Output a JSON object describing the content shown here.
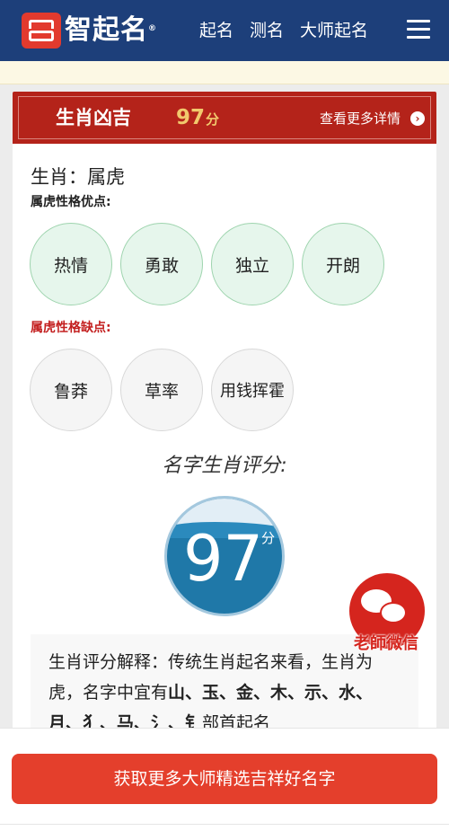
{
  "header": {
    "brand": "智起名",
    "registered": "®",
    "nav": [
      "起名",
      "测名",
      "大师起名"
    ]
  },
  "banner": {
    "title": "生肖凶吉",
    "score": "97",
    "score_unit": "分",
    "more_label": "查看更多详情",
    "arrow": "›"
  },
  "zodiac": {
    "line": "生肖：属虎",
    "good_label": "属虎性格优点:",
    "good_traits": [
      "热情",
      "勇敢",
      "独立",
      "开朗"
    ],
    "bad_label": "属虎性格缺点:",
    "bad_traits": [
      "鲁莽",
      "草率",
      "用钱挥霍"
    ]
  },
  "score": {
    "title": "名字生肖评分:",
    "value": "97",
    "unit": "分"
  },
  "explanation": {
    "prefix": "生肖评分解释：传统生肖起名来看，生肖为虎，名字中宜有",
    "radicals": "山、玉、金、木、示、水、月、犭、马、氵、钅",
    "suffix": "部首起名"
  },
  "wechat": {
    "label": "老師微信"
  },
  "footer": {
    "cta": "获取更多大师精选吉祥好名字"
  },
  "colors": {
    "header_bg": "#1d3f7a",
    "banner_bg": "#b4231a",
    "accent_gold": "#f1c96d",
    "cta_bg": "#e43f2c",
    "good_trait_bg": "#e6f6ec",
    "score_ball": "#1f78a8"
  }
}
